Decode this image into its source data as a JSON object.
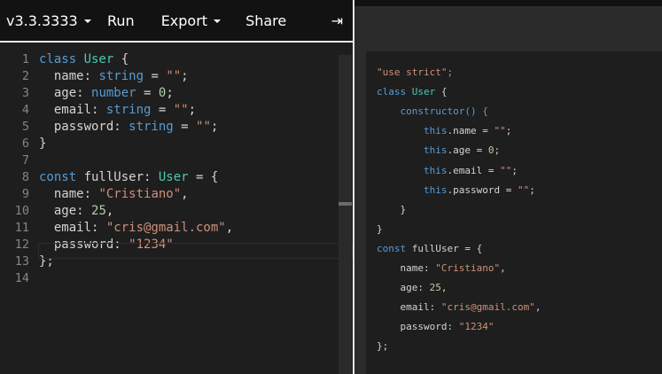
{
  "toolbar": {
    "version_label": "v3.3.3333",
    "run_label": "Run",
    "export_label": "Export",
    "share_label": "Share",
    "collapse_glyph": "⇥"
  },
  "editor": {
    "line_numbers": [
      "1",
      "2",
      "3",
      "4",
      "5",
      "6",
      "7",
      "8",
      "9",
      "10",
      "11",
      "12",
      "13",
      "14"
    ],
    "lines": [
      [
        {
          "t": "class ",
          "c": "kw"
        },
        {
          "t": "User",
          "c": "ty"
        },
        {
          "t": " {",
          "c": "pl"
        }
      ],
      [
        {
          "t": "  name: ",
          "c": "pl"
        },
        {
          "t": "string",
          "c": "kw"
        },
        {
          "t": " = ",
          "c": "pl"
        },
        {
          "t": "\"\"",
          "c": "str"
        },
        {
          "t": ";",
          "c": "pl"
        }
      ],
      [
        {
          "t": "  age: ",
          "c": "pl"
        },
        {
          "t": "number",
          "c": "kw"
        },
        {
          "t": " = ",
          "c": "pl"
        },
        {
          "t": "0",
          "c": "num"
        },
        {
          "t": ";",
          "c": "pl"
        }
      ],
      [
        {
          "t": "  email: ",
          "c": "pl"
        },
        {
          "t": "string",
          "c": "kw"
        },
        {
          "t": " = ",
          "c": "pl"
        },
        {
          "t": "\"\"",
          "c": "str"
        },
        {
          "t": ";",
          "c": "pl"
        }
      ],
      [
        {
          "t": "  password: ",
          "c": "pl"
        },
        {
          "t": "string",
          "c": "kw"
        },
        {
          "t": " = ",
          "c": "pl"
        },
        {
          "t": "\"\"",
          "c": "str"
        },
        {
          "t": ";",
          "c": "pl"
        }
      ],
      [
        {
          "t": "}",
          "c": "pl"
        }
      ],
      [],
      [
        {
          "t": "const ",
          "c": "kw"
        },
        {
          "t": "fullUser: ",
          "c": "pl"
        },
        {
          "t": "User",
          "c": "ty"
        },
        {
          "t": " = {",
          "c": "pl"
        }
      ],
      [
        {
          "t": "  name: ",
          "c": "pl"
        },
        {
          "t": "\"Cristiano\"",
          "c": "str"
        },
        {
          "t": ",",
          "c": "pl"
        }
      ],
      [
        {
          "t": "  age: ",
          "c": "pl"
        },
        {
          "t": "25",
          "c": "num"
        },
        {
          "t": ",",
          "c": "pl"
        }
      ],
      [
        {
          "t": "  email: ",
          "c": "pl"
        },
        {
          "t": "\"cris@gmail.com\"",
          "c": "str"
        },
        {
          "t": ",",
          "c": "pl"
        }
      ],
      [
        {
          "t": "  password: ",
          "c": "pl"
        },
        {
          "t": "\"1234\"",
          "c": "str"
        }
      ],
      [
        {
          "t": "};",
          "c": "pl"
        }
      ],
      []
    ]
  },
  "output": {
    "lines": [
      [
        {
          "t": "\"use strict\";",
          "c": "str"
        }
      ],
      [
        {
          "t": "class ",
          "c": "kw"
        },
        {
          "t": "User",
          "c": "ty"
        },
        {
          "t": " {",
          "c": "pl"
        }
      ],
      [
        {
          "t": "    constructor() {",
          "c": "kw"
        }
      ],
      [
        {
          "t": "        this",
          "c": "kw"
        },
        {
          "t": ".name = ",
          "c": "pl"
        },
        {
          "t": "\"\"",
          "c": "str"
        },
        {
          "t": ";",
          "c": "pl"
        }
      ],
      [
        {
          "t": "        this",
          "c": "kw"
        },
        {
          "t": ".age = ",
          "c": "pl"
        },
        {
          "t": "0",
          "c": "num"
        },
        {
          "t": ";",
          "c": "pl"
        }
      ],
      [
        {
          "t": "        this",
          "c": "kw"
        },
        {
          "t": ".email = ",
          "c": "pl"
        },
        {
          "t": "\"\"",
          "c": "str"
        },
        {
          "t": ";",
          "c": "pl"
        }
      ],
      [
        {
          "t": "        this",
          "c": "kw"
        },
        {
          "t": ".password = ",
          "c": "pl"
        },
        {
          "t": "\"\"",
          "c": "str"
        },
        {
          "t": ";",
          "c": "pl"
        }
      ],
      [
        {
          "t": "    }",
          "c": "pl"
        }
      ],
      [
        {
          "t": "}",
          "c": "pl"
        }
      ],
      [
        {
          "t": "const ",
          "c": "kw"
        },
        {
          "t": "fullUser = {",
          "c": "pl"
        }
      ],
      [
        {
          "t": "    name: ",
          "c": "pl"
        },
        {
          "t": "\"Cristiano\"",
          "c": "str"
        },
        {
          "t": ",",
          "c": "pl"
        }
      ],
      [
        {
          "t": "    age: ",
          "c": "pl"
        },
        {
          "t": "25",
          "c": "num"
        },
        {
          "t": ",",
          "c": "pl"
        }
      ],
      [
        {
          "t": "    email: ",
          "c": "pl"
        },
        {
          "t": "\"cris@gmail.com\"",
          "c": "str"
        },
        {
          "t": ",",
          "c": "pl"
        }
      ],
      [
        {
          "t": "    password: ",
          "c": "pl"
        },
        {
          "t": "\"1234\"",
          "c": "str"
        }
      ],
      [
        {
          "t": "};",
          "c": "pl"
        }
      ]
    ]
  },
  "colors": {
    "keyword": "#569cd6",
    "type": "#4ec9b0",
    "string": "#ce9178",
    "number": "#b5cea8",
    "plain": "#d4d4d4",
    "toolbar_bg": "#121212",
    "editor_bg": "#1e1e1e"
  }
}
